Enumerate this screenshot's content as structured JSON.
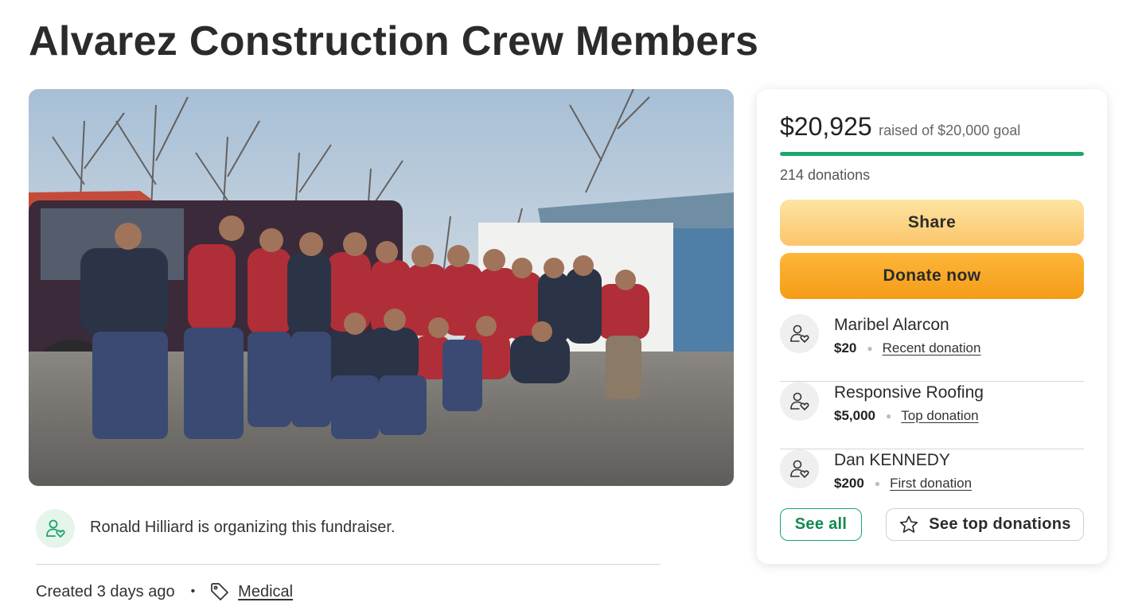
{
  "page": {
    "title": "Alvarez Construction Crew Members"
  },
  "hero": {
    "alt": "Group photo of construction crew members"
  },
  "organizer": {
    "text": "Ronald Hilliard is organizing this fundraiser.",
    "icon": "person-heart-icon"
  },
  "meta": {
    "created": "Created 3 days ago",
    "separator": "•",
    "category": "Medical",
    "category_icon": "tag-icon"
  },
  "donation_card": {
    "raised_amount": "$20,925",
    "goal_text": "raised of $20,000 goal",
    "progress_fraction": 1.0,
    "donations_count": "214 donations",
    "share_label": "Share",
    "donate_label": "Donate now",
    "donors": [
      {
        "name": "Maribel Alarcon",
        "amount": "$20",
        "type": "Recent donation"
      },
      {
        "name": "Responsive Roofing",
        "amount": "$5,000",
        "type": "Top donation"
      },
      {
        "name": "Dan KENNEDY",
        "amount": "$200",
        "type": "First donation"
      }
    ],
    "see_all_label": "See all",
    "see_top_label": "See top donations"
  },
  "colors": {
    "accent_green": "#1aa66a",
    "donate_orange": "#f7a11f",
    "share_yellow": "#fcd385"
  }
}
